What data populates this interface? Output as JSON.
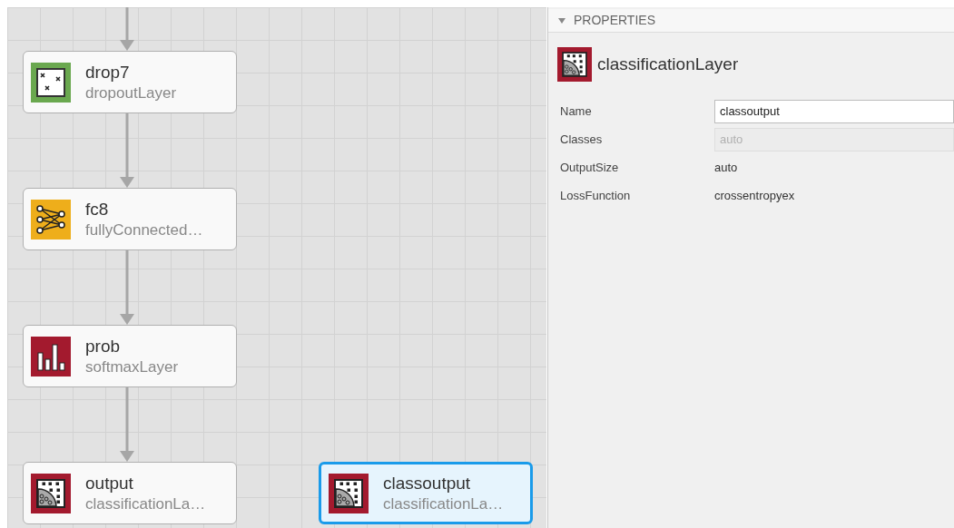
{
  "canvas": {
    "incoming_arrow": true,
    "chain": [
      {
        "name": "drop7",
        "type": "dropoutLayer",
        "kind": "dropout",
        "selected": false
      },
      {
        "name": "fc8",
        "type": "fullyConnected…",
        "kind": "fully_connected",
        "selected": false
      },
      {
        "name": "prob",
        "type": "softmaxLayer",
        "kind": "softmax",
        "selected": false
      },
      {
        "name": "output",
        "type": "classificationLa…",
        "kind": "classification",
        "selected": false
      }
    ],
    "loose": [
      {
        "name": "classoutput",
        "type": "classificationLa…",
        "kind": "classification",
        "selected": true
      }
    ]
  },
  "properties": {
    "header": "PROPERTIES",
    "expanded": true,
    "kind": "classification",
    "layer_type": "classificationLayer",
    "fields": [
      {
        "label": "Name",
        "kind": "input",
        "value": "classoutput",
        "disabled": false
      },
      {
        "label": "Classes",
        "kind": "input",
        "value": "auto",
        "disabled": true
      },
      {
        "label": "OutputSize",
        "kind": "text",
        "value": "auto"
      },
      {
        "label": "LossFunction",
        "kind": "text",
        "value": "crossentropyex"
      }
    ]
  }
}
